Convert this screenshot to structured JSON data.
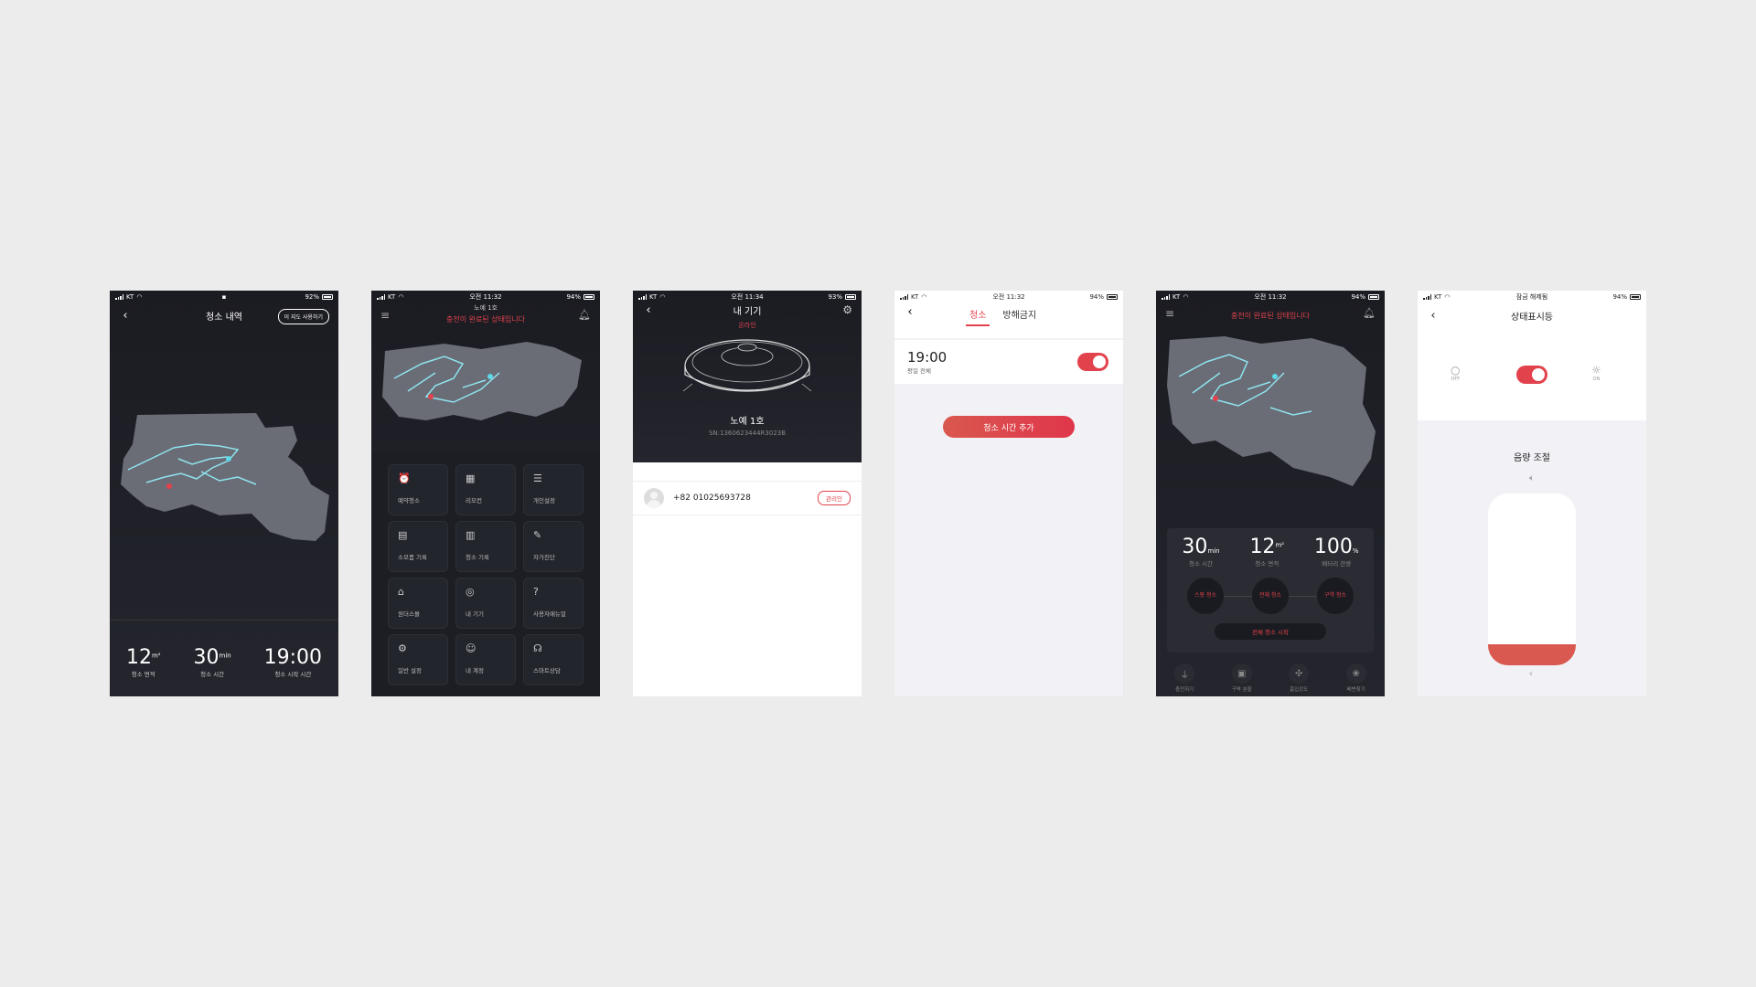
{
  "colors": {
    "accent": "#e2424c",
    "dark_bg": "#1e1f26",
    "light_bg": "#f2f2f6",
    "map": "#6a6c76",
    "path": "#8fe4ee"
  },
  "s1": {
    "carrier": "KT",
    "battery": "92%",
    "title": "청소 내역",
    "use_map_btn": "이 지도 사용하기",
    "stats": [
      {
        "value": "12",
        "unit": "m²",
        "label": "청소 면적"
      },
      {
        "value": "30",
        "unit": "min",
        "label": "청소 시간"
      },
      {
        "value": "19:00",
        "unit": "",
        "label": "청소 시작 시간"
      }
    ]
  },
  "s2": {
    "carrier": "KT",
    "time": "오전 11:32",
    "battery": "94%",
    "device": "노예 1호",
    "status": "충전이 완료된 상태입니다",
    "menu": [
      {
        "icon": "alarm-icon",
        "glyph": "⏰",
        "label": "예약청소"
      },
      {
        "icon": "remote-icon",
        "glyph": "▦",
        "label": "리모컨"
      },
      {
        "icon": "sliders-icon",
        "glyph": "☰",
        "label": "개인설정"
      },
      {
        "icon": "document-icon",
        "glyph": "▤",
        "label": "소모품 기록"
      },
      {
        "icon": "clipboard-icon",
        "glyph": "▥",
        "label": "청소 기록"
      },
      {
        "icon": "tools-icon",
        "glyph": "✎",
        "label": "자가진단"
      },
      {
        "icon": "store-icon",
        "glyph": "⌂",
        "label": "원더스몰"
      },
      {
        "icon": "robot-icon",
        "glyph": "◎",
        "label": "내 기기"
      },
      {
        "icon": "help-icon",
        "glyph": "?",
        "label": "사용자매뉴얼"
      },
      {
        "icon": "gear-icon",
        "glyph": "⚙",
        "label": "일반 설정"
      },
      {
        "icon": "user-icon",
        "glyph": "☺",
        "label": "내 계정"
      },
      {
        "icon": "headset-icon",
        "glyph": "☊",
        "label": "스마트상담"
      }
    ]
  },
  "s3": {
    "carrier": "KT",
    "time": "오전 11:34",
    "battery": "93%",
    "title": "내 기기",
    "online": "온라인",
    "device": "노예 1호",
    "serial": "SN:1360623444R3023B",
    "phone": "+82 01025693728",
    "admin": "관리인"
  },
  "s4": {
    "carrier": "KT",
    "time": "오전 11:32",
    "battery": "94%",
    "tabs": [
      "청소",
      "방해금지"
    ],
    "schedule_time": "19:00",
    "schedule_days": "평일 전체",
    "add_btn": "청소 시간 추가"
  },
  "s5": {
    "carrier": "KT",
    "time": "오전 11:32",
    "battery": "94%",
    "status": "충전이 완료된 상태입니다",
    "stats": [
      {
        "value": "30",
        "unit": "min",
        "label": "청소 시간"
      },
      {
        "value": "12",
        "unit": "m²",
        "label": "청소 면적"
      },
      {
        "value": "100",
        "unit": "%",
        "label": "배터리 잔량"
      }
    ],
    "modes": [
      "스팟 청소",
      "전체 청소",
      "구역 청소"
    ],
    "start_btn": "전체 청소 시작",
    "nav": [
      {
        "icon": "charge-icon",
        "glyph": "⏚",
        "label": "충전하기"
      },
      {
        "icon": "area-icon",
        "glyph": "▣",
        "label": "구역 분할"
      },
      {
        "icon": "fan-icon",
        "glyph": "✣",
        "label": "흡입강도"
      },
      {
        "icon": "pet-icon",
        "glyph": "❀",
        "label": "배변찾기"
      }
    ]
  },
  "s6": {
    "carrier": "KT",
    "lock": "잠금 해제됨",
    "battery": "94%",
    "title": "상태표시등",
    "off": "OFF",
    "on": "ON",
    "volume_title": "음량 조절",
    "volume_level": 0.12
  }
}
